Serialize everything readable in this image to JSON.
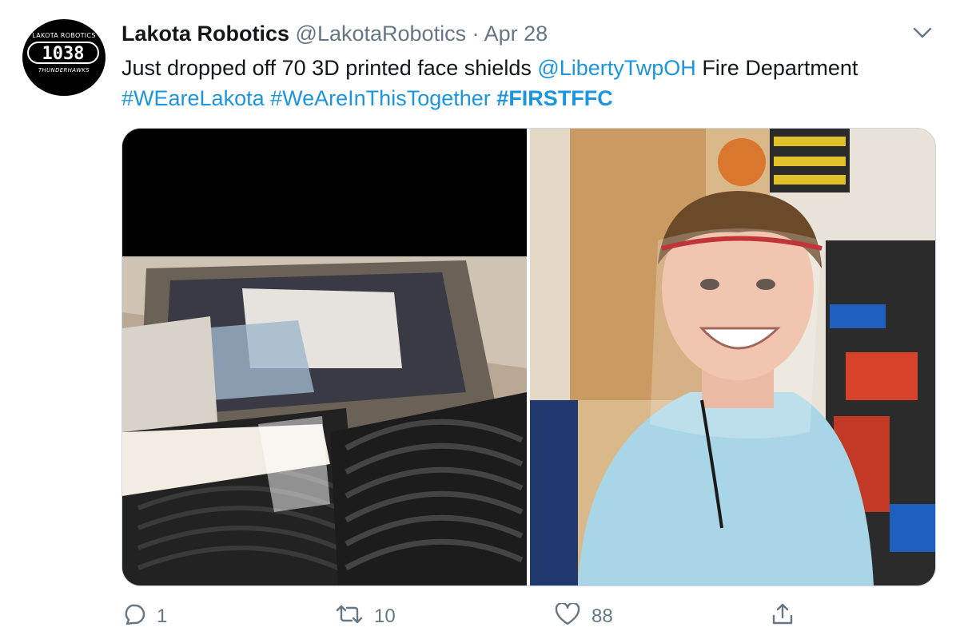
{
  "avatar": {
    "top_text": "LAKOTA ROBOTICS",
    "number": "1038",
    "bottom_text": "THUNDERHAWKS"
  },
  "tweet": {
    "name": "Lakota Robotics",
    "handle": "@LakotaRobotics",
    "separator": "·",
    "date": "Apr 28",
    "text_part1": "Just dropped off 70 3D printed face shields ",
    "mention": "@LibertyTwpOH",
    "text_part2": " Fire Department ",
    "hashtag1": "#WEareLakota",
    "hashtag2": "#WeAreInThisTogether",
    "hashtag3": "#FIRSTFFC"
  },
  "actions": {
    "reply_count": "1",
    "retweet_count": "10",
    "like_count": "88"
  },
  "icons": {
    "caret": "chevron-down-icon",
    "reply": "reply-icon",
    "retweet": "retweet-icon",
    "like": "heart-icon",
    "share": "share-icon"
  },
  "colors": {
    "link": "#1b95e0",
    "secondary_text": "#657786",
    "primary_text": "#14171a"
  }
}
